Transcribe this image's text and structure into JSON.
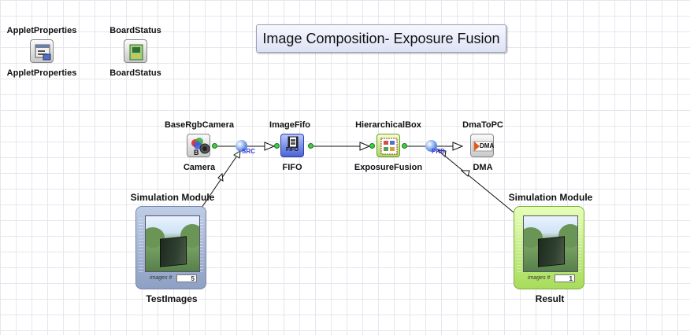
{
  "window": {
    "title": "Image Composition- Exposure Fusion"
  },
  "applet": {
    "applet_properties": {
      "top_label": "AppletProperties",
      "bottom_label": "AppletProperties",
      "icon": "properties-window-icon"
    },
    "board_status": {
      "top_label": "BoardStatus",
      "bottom_label": "BoardStatus",
      "icon": "board-status-icon"
    }
  },
  "pipeline": {
    "camera": {
      "type_label": "BaseRgbCamera",
      "name_label": "Camera",
      "icon": "camera-icon"
    },
    "fifo": {
      "type_label": "ImageFifo",
      "name_label": "FIFO",
      "icon_text": "FIFO",
      "icon": "film-fifo-icon"
    },
    "exposure_fusion": {
      "type_label": "HierarchicalBox",
      "name_label": "ExposureFusion",
      "icon": "hierarchical-box-icon"
    },
    "dma": {
      "type_label": "DmaToPC",
      "name_label": "DMA",
      "icon_text": "DMA",
      "icon": "dma-icon"
    }
  },
  "tags": {
    "src": "SRC",
    "prb": "PRB"
  },
  "simulation": {
    "test_images": {
      "header": "Simulation Module",
      "name": "TestImages",
      "counter_label": "images #",
      "count": "5"
    },
    "result": {
      "header": "Simulation Module",
      "name": "Result",
      "counter_label": "images #",
      "count": "1"
    }
  },
  "colors": {
    "grid": "#e6e6ee",
    "port": "#3fcf3f",
    "tag": "#3a3ad6",
    "sim_blue": "#8ea0c4",
    "sim_green": "#a8dc5c"
  }
}
